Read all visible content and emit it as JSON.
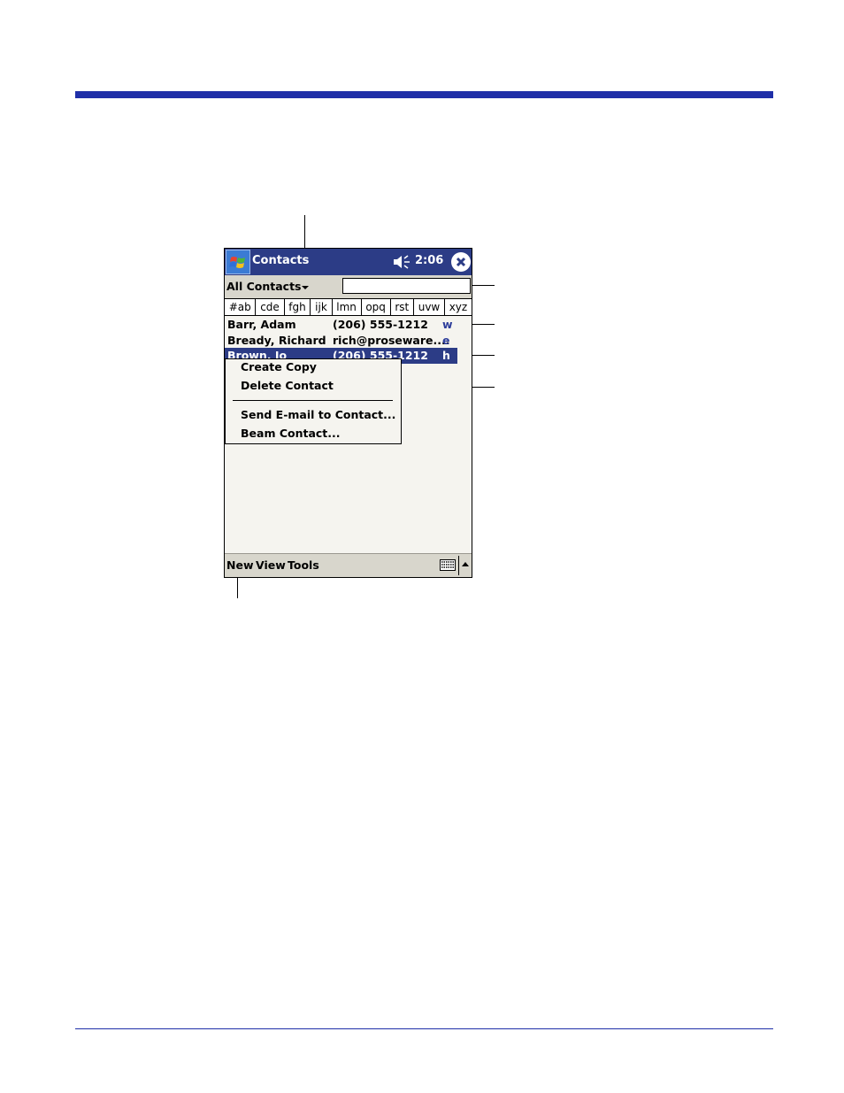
{
  "device": {
    "app_title": "Contacts",
    "clock": "2:06",
    "category": "All Contacts",
    "search_value": "",
    "abc_tabs": [
      "#ab",
      "cde",
      "fgh",
      "ijk",
      "lmn",
      "opq",
      "rst",
      "uvw",
      "xyz"
    ],
    "contacts": [
      {
        "name": "Barr, Adam",
        "detail": "(206) 555-1212",
        "type": "w"
      },
      {
        "name": "Bready, Richard",
        "detail": "rich@proseware....",
        "type": "e"
      },
      {
        "name": "Brown, Jo",
        "detail": "(206) 555-1212",
        "type": "h"
      }
    ],
    "context_menu": {
      "items": [
        "Create Copy",
        "Delete Contact",
        "Send E-mail to Contact...",
        "Beam Contact..."
      ]
    },
    "menubar": {
      "new": "New",
      "view": "View",
      "tools": "Tools"
    },
    "colors": {
      "title_bar": "#2c3c86",
      "selection": "#2c3c86",
      "rule": "#1f2fa8"
    }
  }
}
